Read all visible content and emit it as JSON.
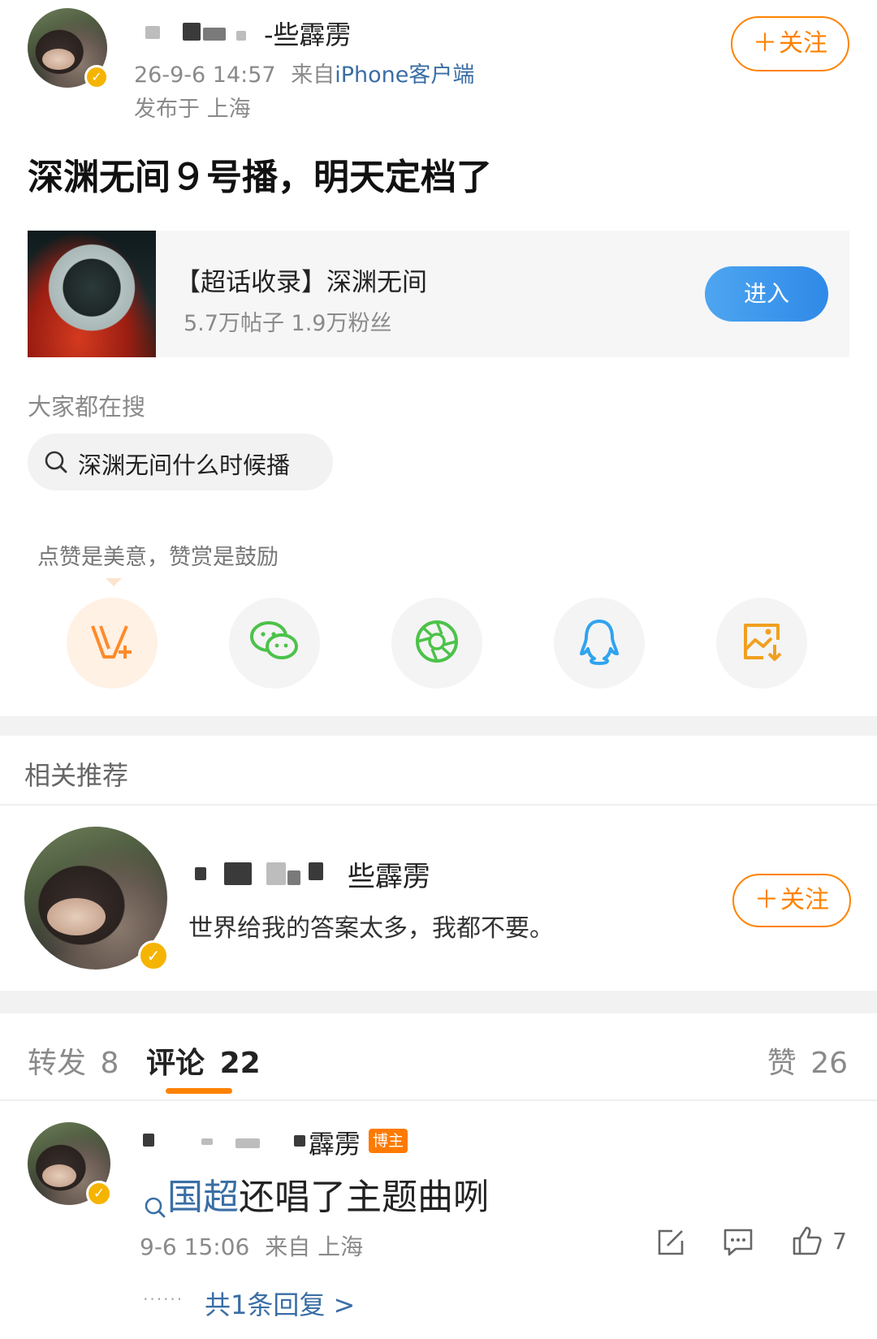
{
  "post": {
    "author_suffix": "-些霹雳",
    "timestamp": "26-9-6 14:57",
    "source_prefix": "来自",
    "source_client": "iPhone客户端",
    "location": "发布于 上海",
    "follow_label": "关注",
    "body_text": "深渊无间９号播，明天定档了"
  },
  "topic_card": {
    "title": "【超话收录】深渊无间",
    "stats": "5.7万帖子 1.9万粉丝",
    "enter_label": "进入"
  },
  "trending": {
    "heading": "大家都在搜",
    "query": "深渊无间什么时候播"
  },
  "reward": {
    "tooltip": "点赞是美意，赞赏是鼓励"
  },
  "share_icons": [
    "vplus-reward-icon",
    "wechat-icon",
    "moments-icon",
    "qq-icon",
    "save-image-icon"
  ],
  "colors": {
    "accent_orange": "#ff8200",
    "link_blue": "#3a6ea5",
    "enter_blue": "#2f8ae8",
    "wechat_green": "#4cc24a",
    "qq_blue": "#2fa3ef",
    "save_orange": "#f0a020"
  },
  "related": {
    "heading": "相关推荐",
    "name_suffix": "些霹雳",
    "bio": "世界给我的答案太多，我都不要。",
    "follow_label": "关注"
  },
  "tabs": {
    "repost_label": "转发",
    "repost_count": "8",
    "comment_label": "评论",
    "comment_count": "22",
    "like_label": "赞",
    "like_count": "26"
  },
  "comment": {
    "name_suffix": "霹雳",
    "badge": "博主",
    "link_text": "国超",
    "text": "还唱了主题曲咧",
    "time": "9-6 15:06",
    "source": "来自 上海",
    "like_count": "7",
    "replies_link": "共1条回复 >"
  }
}
